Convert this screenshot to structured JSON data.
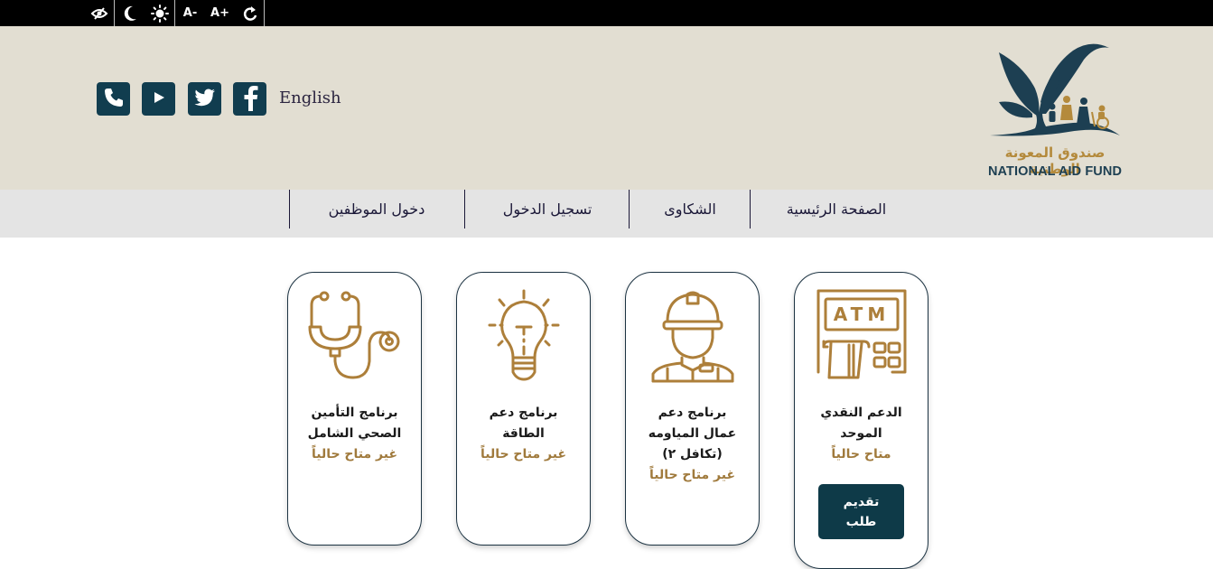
{
  "accessibility_bar": {
    "buttons": [
      {
        "name": "hide-eye",
        "label": ""
      },
      {
        "name": "dark-mode",
        "label": ""
      },
      {
        "name": "light-mode",
        "label": ""
      },
      {
        "name": "font-decrease",
        "label": "A-"
      },
      {
        "name": "font-increase",
        "label": "A+"
      },
      {
        "name": "reset",
        "label": ""
      }
    ]
  },
  "header": {
    "language_link": "English",
    "social": [
      "phone",
      "youtube",
      "twitter",
      "facebook"
    ],
    "logo": {
      "arabic_name": "صندوق المعونة الوطنية",
      "english_name": "NATIONAL AID FUND"
    }
  },
  "nav": {
    "items": [
      {
        "label": "الصفحة الرئيسية"
      },
      {
        "label": "الشكاوى"
      },
      {
        "label": "تسجيل الدخول"
      },
      {
        "label": "دخول الموظفين"
      }
    ]
  },
  "programs": [
    {
      "title_lines": [
        "الدعم النقدي",
        "الموحد"
      ],
      "status": "متاح حالياً",
      "icon": "atm-icon",
      "apply_label": "تقديم طلب"
    },
    {
      "title_lines": [
        "برنامج دعم",
        "عمال المياومه",
        "(تكافل ٢)"
      ],
      "status": "غير متاح حالياً",
      "icon": "worker-icon"
    },
    {
      "title_lines": [
        "برنامج دعم",
        "الطاقة"
      ],
      "status": "غير متاح حالياً",
      "icon": "lightbulb-icon"
    },
    {
      "title_lines": [
        "برنامج التأمين",
        "الصحي الشامل"
      ],
      "status": "غير متاح حالياً",
      "icon": "stethoscope-icon"
    }
  ],
  "colors": {
    "brand_dark": "#113d4f",
    "gold": "#ad7f3a",
    "header_bg": "#e2ded2",
    "nav_bg": "#e4e4e4"
  }
}
